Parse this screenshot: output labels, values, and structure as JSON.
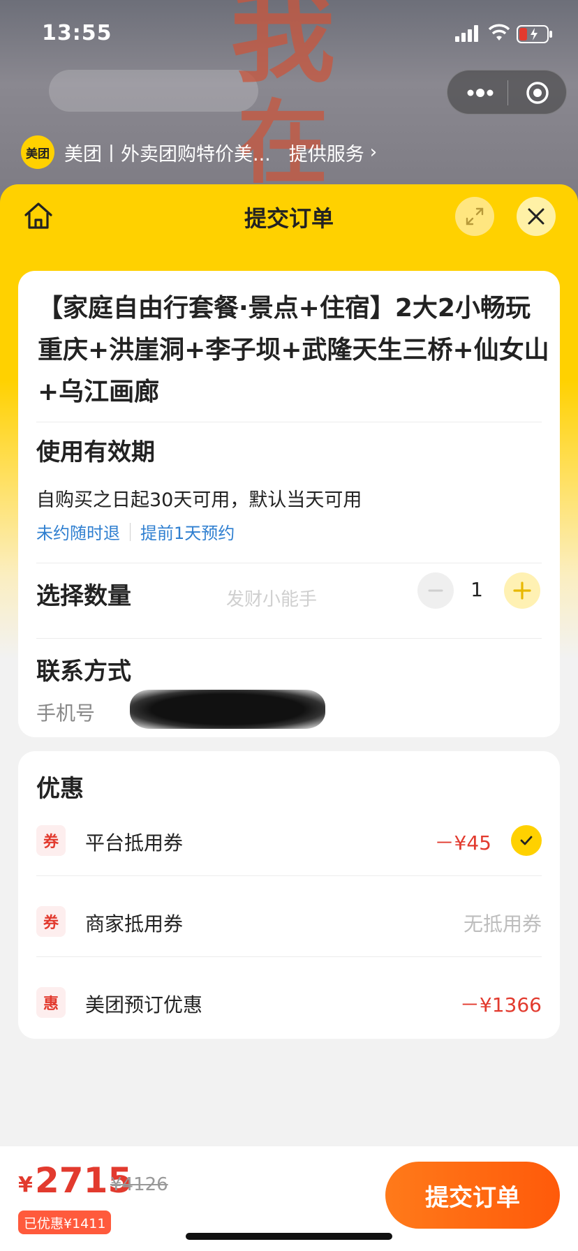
{
  "status_bar": {
    "time": "13:55"
  },
  "background": {
    "poster_text": [
      "我",
      "在"
    ]
  },
  "provider": {
    "logo_text": "美团",
    "name": "美团丨外卖团购特价美...",
    "service_label": "提供服务",
    "chevron": "›"
  },
  "header": {
    "title": "提交订单"
  },
  "order": {
    "product_title": "【家庭自由行套餐·景点+住宿】2大2小畅玩重庆+洪崖洞+李子坝+武隆天生三桥+仙女山+乌江画廊",
    "validity_label": "使用有效期",
    "validity_text": "自购买之日起30天可用，默认当天可用",
    "tags": [
      "未约随时退",
      "提前1天预约"
    ],
    "quantity_label": "选择数量",
    "quantity": "1",
    "watermark": "发财小能手",
    "contact_label": "联系方式",
    "phone_label": "手机号"
  },
  "discounts": {
    "title": "优惠",
    "items": [
      {
        "badge": "券",
        "name": "平台抵用券",
        "value": "－¥45",
        "checked": true
      },
      {
        "badge": "券",
        "name": "商家抵用券",
        "value": "无抵用券",
        "checked": false
      },
      {
        "badge": "惠",
        "name": "美团预订优惠",
        "value": "－¥1366",
        "checked": false
      }
    ]
  },
  "bottom": {
    "currency": "¥",
    "price": "2715",
    "original_price": "¥4126",
    "saved_text": "已优惠¥1411",
    "submit_label": "提交订单"
  },
  "colors": {
    "brand_yellow": "#ffd100",
    "price_red": "#e23a2e",
    "link_blue": "#2f7fd0",
    "submit_orange": "#ff6a12"
  },
  "icons": [
    "home-icon",
    "expand-icon",
    "close-icon",
    "minus-icon",
    "plus-icon",
    "check-icon",
    "more-dots-icon",
    "target-icon",
    "signal-icon",
    "wifi-icon",
    "battery-icon"
  ]
}
